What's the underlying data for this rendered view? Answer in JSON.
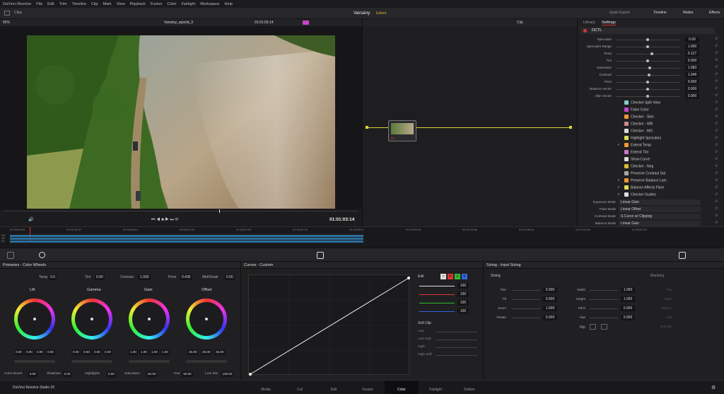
{
  "menu": [
    "DaVinci Resolve",
    "File",
    "Edit",
    "Trim",
    "Timeline",
    "Clip",
    "Mark",
    "View",
    "Playback",
    "Fusion",
    "Color",
    "Fairlight",
    "Workspace",
    "Help"
  ],
  "top": {
    "clips_label": "Clips",
    "project": "Varsány",
    "status": "Edited",
    "quick_export": "Quick Export",
    "timeline": "Timeline",
    "nodes": "Nodes",
    "effects": "Effects"
  },
  "viewer": {
    "zoom": "85%",
    "timeline_name": "Varsány_epizód_3",
    "timecode": "01:01:03:14",
    "timecode_ctrl": "01:01:03:14"
  },
  "nodebar": {
    "mode": "Clip"
  },
  "node": {
    "label": "01"
  },
  "right": {
    "tab_library": "Library",
    "tab_settings": "Settings",
    "section": "DCTL",
    "params": [
      {
        "label": "Speculars",
        "value": "0.00",
        "knob": 0.5
      },
      {
        "label": "Speculars Range",
        "value": "1.000",
        "knob": 0.5
      },
      {
        "label": "Temp",
        "value": "0.127",
        "knob": 0.57
      },
      {
        "label": "Tint",
        "value": "0.000",
        "knob": 0.5
      },
      {
        "label": "Saturation",
        "value": "1.083",
        "knob": 0.53
      },
      {
        "label": "Contrast",
        "value": "1.046",
        "knob": 0.52
      },
      {
        "label": "Pivot",
        "value": "0.000",
        "knob": 0.5
      },
      {
        "label": "Balance Vector",
        "value": "0.000",
        "knob": 0.5
      },
      {
        "label": "Skin Vector",
        "value": "0.000",
        "knob": 0.5
      }
    ],
    "checks": [
      {
        "label": "Checker Split View",
        "checked": false,
        "color": "#8cc"
      },
      {
        "label": "False Color",
        "checked": false,
        "color": "#c4c"
      },
      {
        "label": "Checker - Skin",
        "checked": false,
        "color": "#e93"
      },
      {
        "label": "Checker - WB",
        "checked": false,
        "color": "#c88"
      },
      {
        "label": "Checker - MG",
        "checked": false,
        "color": "#ddd"
      },
      {
        "label": "Highlight Speculars",
        "checked": false,
        "color": "#dd5"
      },
      {
        "label": "Extend Temp",
        "checked": true,
        "color": "#e93"
      },
      {
        "label": "Extend Tint",
        "checked": false,
        "color": "#c7c"
      },
      {
        "label": "Show Curve",
        "checked": false,
        "color": "#ddd"
      },
      {
        "label": "Checker - Neg",
        "checked": false,
        "color": "#db3"
      },
      {
        "label": "Preserve Contrast Sat",
        "checked": false,
        "color": "#aaa"
      },
      {
        "label": "Preserve Balance Lum",
        "checked": true,
        "color": "#e93"
      },
      {
        "label": "Balance Affects Flare",
        "checked": true,
        "color": "#dd5"
      },
      {
        "label": "Checker Guides",
        "checked": true,
        "color": "#ddd"
      }
    ],
    "modes": [
      {
        "label": "Exposure Mode",
        "value": "Linear Gain"
      },
      {
        "label": "Flare Mode",
        "value": "Linear Offset"
      },
      {
        "label": "Contrast Mode",
        "value": "S-Curve w/ Clipping"
      },
      {
        "label": "Balance Mode",
        "value": "Linear Gain"
      }
    ]
  },
  "timeline": {
    "ticks": [
      "01:00:00:00",
      "01:02:44:07",
      "01:05:28:14",
      "01:08:12:21",
      "01:10:57:03",
      "01:13:41:10",
      "01:16:25:17",
      "01:19:09:24",
      "01:21:54:06",
      "01:24:38:13",
      "01:27:22:20",
      "01:30:07:02"
    ],
    "tracks": [
      "V3",
      "V2",
      "V1"
    ]
  },
  "wheels": {
    "title": "Primaries - Color Wheels",
    "top": [
      {
        "label": "Temp",
        "value": "0.0"
      },
      {
        "label": "Tint",
        "value": "0.00"
      },
      {
        "label": "Contrast",
        "value": "1.000"
      },
      {
        "label": "Pivot",
        "value": "0.435"
      },
      {
        "label": "Mid/Detail",
        "value": "0.00"
      }
    ],
    "items": [
      {
        "label": "Lift",
        "values": [
          "0.00",
          "0.00",
          "0.00",
          "0.00"
        ]
      },
      {
        "label": "Gamma",
        "values": [
          "0.00",
          "0.00",
          "0.00",
          "0.00"
        ]
      },
      {
        "label": "Gain",
        "values": [
          "1.00",
          "1.00",
          "1.00",
          "1.00"
        ]
      },
      {
        "label": "Offset",
        "values": [
          "25.00",
          "25.00",
          "25.00"
        ]
      }
    ],
    "bottom": [
      {
        "label": "Color Boost",
        "value": "0.00"
      },
      {
        "label": "Shadows",
        "value": "0.00"
      },
      {
        "label": "Highlights",
        "value": "0.00"
      },
      {
        "label": "Saturation",
        "value": "50.00"
      },
      {
        "label": "Hue",
        "value": "50.00"
      },
      {
        "label": "Lum Mix",
        "value": "100.00"
      }
    ]
  },
  "curves": {
    "title": "Curves - Custom",
    "edit": "Edit",
    "channels": [
      "Y",
      "R",
      "G",
      "B"
    ],
    "intensity": [
      "100",
      "100",
      "100",
      "100"
    ],
    "softclip": "Soft Clip",
    "softclip_rows": [
      "Low",
      "Low Soft",
      "High",
      "High Soft"
    ],
    "colors": {
      "y": "#dddddd",
      "r": "#d33",
      "g": "#3b3",
      "b": "#36d"
    }
  },
  "sizing": {
    "title": "Sizing - Input Sizing",
    "section": "Sizing",
    "blanking": "Blanking",
    "left": [
      {
        "label": "Pan",
        "value": "0.000"
      },
      {
        "label": "Tilt",
        "value": "0.000"
      },
      {
        "label": "Zoom",
        "value": "1.000"
      },
      {
        "label": "Rotate",
        "value": "0.000"
      }
    ],
    "right": [
      {
        "label": "Width",
        "value": "1.000"
      },
      {
        "label": "Height",
        "value": "1.000"
      },
      {
        "label": "Pitch",
        "value": "0.000"
      },
      {
        "label": "Yaw",
        "value": "0.000"
      }
    ],
    "flip": "Flip",
    "blank": [
      "Top",
      "Right",
      "Bottom",
      "Left",
      "Smooth"
    ]
  },
  "pages": {
    "brand": "DaVinci Resolve Studio 20",
    "items": [
      "Media",
      "Cut",
      "Edit",
      "Fusion",
      "Color",
      "Fairlight",
      "Deliver"
    ],
    "active": "Color"
  }
}
